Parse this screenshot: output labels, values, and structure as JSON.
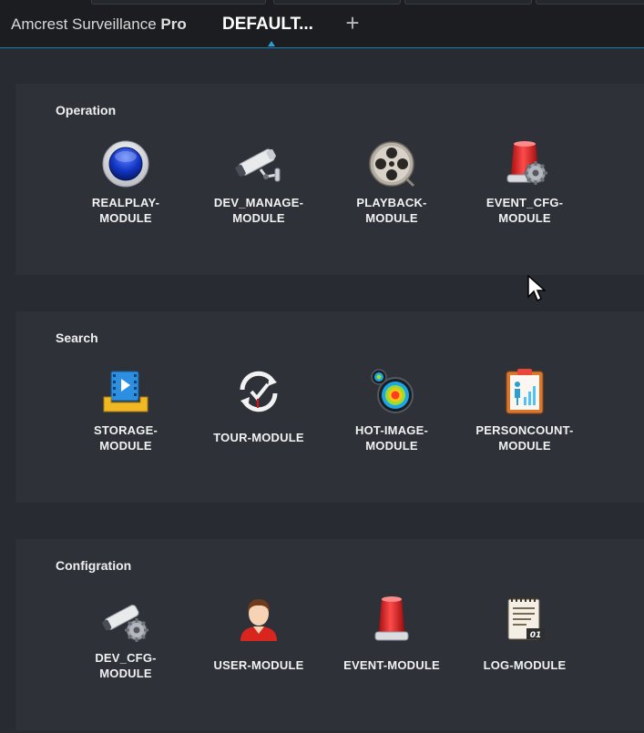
{
  "window": {
    "app_name": "Amcrest Surveillance",
    "app_suffix": "Pro",
    "active_tab": "DEFAULT...",
    "add_tab": "+"
  },
  "sections": [
    {
      "title": "Operation",
      "modules": [
        {
          "label": "REALPLAY-\nMODULE",
          "icon": "realplay-icon"
        },
        {
          "label": "DEV_MANAGE-\nMODULE",
          "icon": "camera-icon"
        },
        {
          "label": "PLAYBACK-\nMODULE",
          "icon": "film-reel-icon"
        },
        {
          "label": "EVENT_CFG-\nMODULE",
          "icon": "alarm-gear-icon"
        }
      ]
    },
    {
      "title": "Search",
      "modules": [
        {
          "label": "STORAGE-\nMODULE",
          "icon": "storage-video-icon"
        },
        {
          "label": "TOUR-MODULE",
          "icon": "tour-refresh-icon"
        },
        {
          "label": "HOT-IMAGE-\nMODULE",
          "icon": "heatmap-icon"
        },
        {
          "label": "PERSONCOUNT-\nMODULE",
          "icon": "person-chart-icon"
        }
      ]
    },
    {
      "title": "Configration",
      "modules": [
        {
          "label": "DEV_CFG-\nMODULE",
          "icon": "camera-gear-icon"
        },
        {
          "label": "USER-MODULE",
          "icon": "user-icon"
        },
        {
          "label": "EVENT-MODULE",
          "icon": "alarm-light-icon"
        },
        {
          "label": "LOG-MODULE",
          "icon": "log-document-icon"
        }
      ],
      "log_icon_text": "01"
    }
  ]
}
